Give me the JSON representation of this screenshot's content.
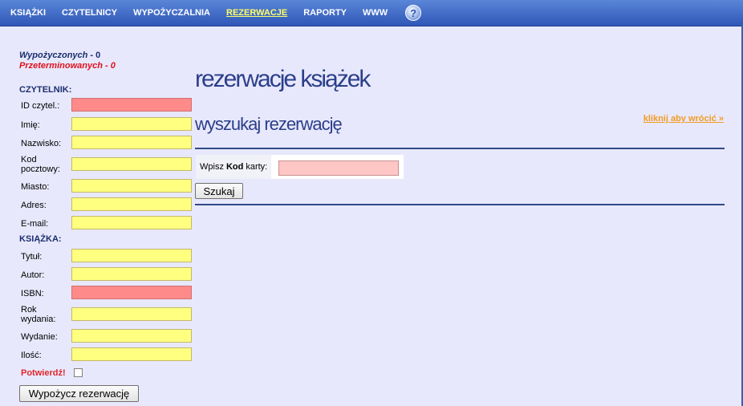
{
  "nav": {
    "items": [
      {
        "label": "KSIĄŻKI",
        "active": false
      },
      {
        "label": "CZYTELNICY",
        "active": false
      },
      {
        "label": "WYPOŻYCZALNIA",
        "active": false
      },
      {
        "label": "REZERWACJE",
        "active": true
      },
      {
        "label": "RAPORTY",
        "active": false
      },
      {
        "label": "WWW",
        "active": false
      }
    ],
    "help_glyph": "?",
    "help_icon": "help-icon"
  },
  "stats": {
    "borrowed_label": "Wypożyczonych",
    "borrowed_sep": " - ",
    "borrowed_value": "0",
    "overdue_label": "Przeterminowanych",
    "overdue_sep": " - ",
    "overdue_value": "0"
  },
  "reader_section": {
    "title": "CZYTELNIK:",
    "fields": [
      {
        "label": "ID czytel.:",
        "value": ""
      },
      {
        "label": "Imię:",
        "value": ""
      },
      {
        "label": "Nazwisko:",
        "value": ""
      },
      {
        "label": "Kod pocztowy:",
        "value": ""
      },
      {
        "label": "Miasto:",
        "value": ""
      },
      {
        "label": "Adres:",
        "value": ""
      },
      {
        "label": "E-mail:",
        "value": ""
      }
    ]
  },
  "book_section": {
    "title": "KSIĄŻKA:",
    "fields": [
      {
        "label": "Tytuł:",
        "value": ""
      },
      {
        "label": "Autor:",
        "value": ""
      },
      {
        "label": "ISBN:",
        "value": ""
      },
      {
        "label": "Rok wydania:",
        "value": ""
      },
      {
        "label": "Wydanie:",
        "value": ""
      },
      {
        "label": "Ilość:",
        "value": ""
      }
    ]
  },
  "confirm": {
    "label": "Potwierdź!",
    "checked": false
  },
  "lend_button": {
    "label": "Wypożycz rezerwację"
  },
  "main": {
    "title": "rezerwacje książek",
    "subtitle": "wyszukaj rezerwację",
    "back_link": "kliknij aby wrócić »",
    "search": {
      "label_prefix": "Wpisz",
      "label_bold": "Kod",
      "label_suffix": "karty:",
      "value": ""
    },
    "search_button": "Szukaj"
  },
  "colors": {
    "nav_bg": "#3b64c4",
    "active_nav": "#ffff66",
    "page_bg": "#e8e8fd",
    "heading": "#2b3f8a",
    "required_field": "#ff8a8a",
    "field": "#ffff80",
    "alert": "#e0101a",
    "link": "#f39a1f"
  }
}
